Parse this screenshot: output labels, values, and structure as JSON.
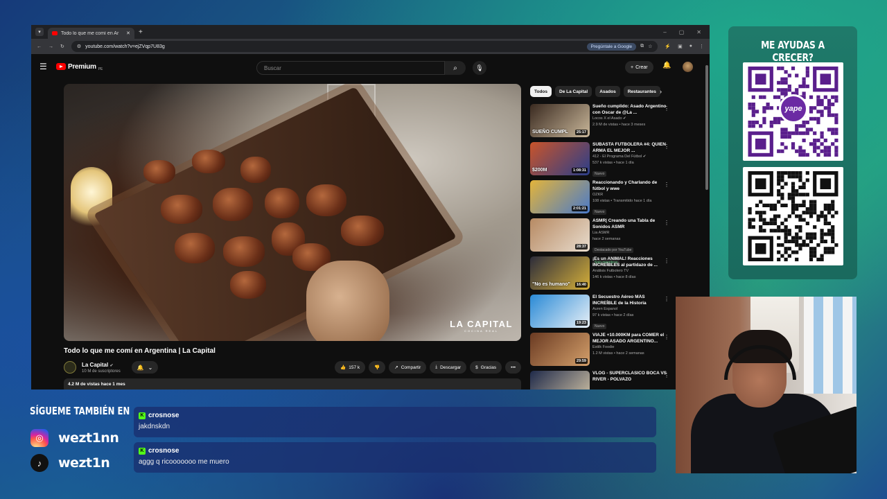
{
  "browser": {
    "tab_title": "Todo lo que me comí en Ar",
    "url": "youtube.com/watch?v=ejZVqp7U83g",
    "ask_google": "Pregúntale a Google"
  },
  "youtube": {
    "logo": "Premium",
    "logo_region": "PE",
    "search_placeholder": "Buscar",
    "create_label": "Crear",
    "video": {
      "watermark_main": "LA CAPITAL",
      "watermark_sub": "COCINA REAL",
      "title": "Todo lo que me comí en Argentina | La Capital",
      "channel": "La Capital",
      "subscribers": "10 M de suscriptores",
      "likes": "157 k",
      "share": "Compartir",
      "download": "Descargar",
      "thanks": "Gracias",
      "views_date": "4.2 M de vistas  hace 1 mes"
    },
    "chips": [
      "Todos",
      "De La Capital",
      "Asados",
      "Restaurantes"
    ],
    "recommendations": [
      {
        "title": "Sueño cumplido: Asado Argentino con Oscar de @La ...",
        "channel": "Locos X el Asado ✔",
        "meta": "2.9 M de vistas • hace 3 meses",
        "duration": "25:17",
        "badge": "",
        "badge2": "",
        "colors": [
          "#3a2a20",
          "#c9b79a"
        ],
        "overlay": "SUEÑO CUMPL"
      },
      {
        "title": "SUBASTA FUTBOLERA #4: QUIEN ARMA EL MEJOR ...",
        "channel": "412 - El Programa Del Fútbol ✔",
        "meta": "537 k vistas • hace 1 día",
        "duration": "1:08:31",
        "badge": "Nuevo",
        "badge2": "",
        "colors": [
          "#c9542a",
          "#2a3e8a"
        ],
        "overlay": "$200M"
      },
      {
        "title": "Reaccionando y Charlando de fútbol y wwe",
        "channel": "OZKR",
        "meta": "108 vistas • Transmitido hace 1 día",
        "duration": "2:01:21",
        "badge": "Nuevo",
        "badge2": "",
        "colors": [
          "#e3b43a",
          "#4a7ac9"
        ],
        "overlay": ""
      },
      {
        "title": "ASMR| Creando una Tabla de Sonidos ASMR",
        "channel": "Lia ASMR",
        "meta": "hace 2 semanas",
        "duration": "28:37",
        "badge": "Destacado por YouTube",
        "badge2": "Solo miembros",
        "colors": [
          "#b78a63",
          "#e8dccd"
        ],
        "overlay": ""
      },
      {
        "title": "¡Es un ANIMAL! Reacciones INCREÍBLES al partidazo de ...",
        "channel": "Análisis Futbolero TV",
        "meta": "146 k vistas • hace 8 días",
        "duration": "16:40",
        "badge": "",
        "badge2": "",
        "colors": [
          "#2c2c3a",
          "#d6b03a"
        ],
        "overlay": "\"No es humano\""
      },
      {
        "title": "El Secuestro Aéreo MÁS INCREÍBLE de la Historia",
        "channel": "Auren Espanol",
        "meta": "97 k vistas • hace 2 días",
        "duration": "19:23",
        "badge": "Nuevo",
        "badge2": "",
        "colors": [
          "#2a8ad6",
          "#e8f0f7"
        ],
        "overlay": ""
      },
      {
        "title": "VIAJÉ +10.000KM para COMER el MEJOR ASADO ARGENTINO...",
        "channel": "Estilk Foodie",
        "meta": "1.2 M vistas • hace 2 semanas",
        "duration": "29:59",
        "badge": "",
        "badge2": "",
        "colors": [
          "#6a3a22",
          "#d4a06b"
        ],
        "overlay": ""
      },
      {
        "title": "VLOG - SUPERCLASICO BOCA VS RIVER - POLVAZO",
        "channel": "",
        "meta": "",
        "duration": "",
        "badge": "",
        "badge2": "",
        "colors": [
          "#1f2a4a",
          "#d6c7a8"
        ],
        "overlay": ""
      }
    ]
  },
  "overlay": {
    "qr_title": "ME AYUDAS A CRECER?",
    "yape": "yape",
    "follow_title": "SÍGUEME TAMBIÉN EN",
    "instagram_handle": "wezt1nn",
    "tiktok_handle": "wezt1n",
    "chat": [
      {
        "user": "crosnose",
        "message": "jakdnskdn"
      },
      {
        "user": "crosnose",
        "message": "aggg q ricooooooo me muero"
      }
    ]
  }
}
